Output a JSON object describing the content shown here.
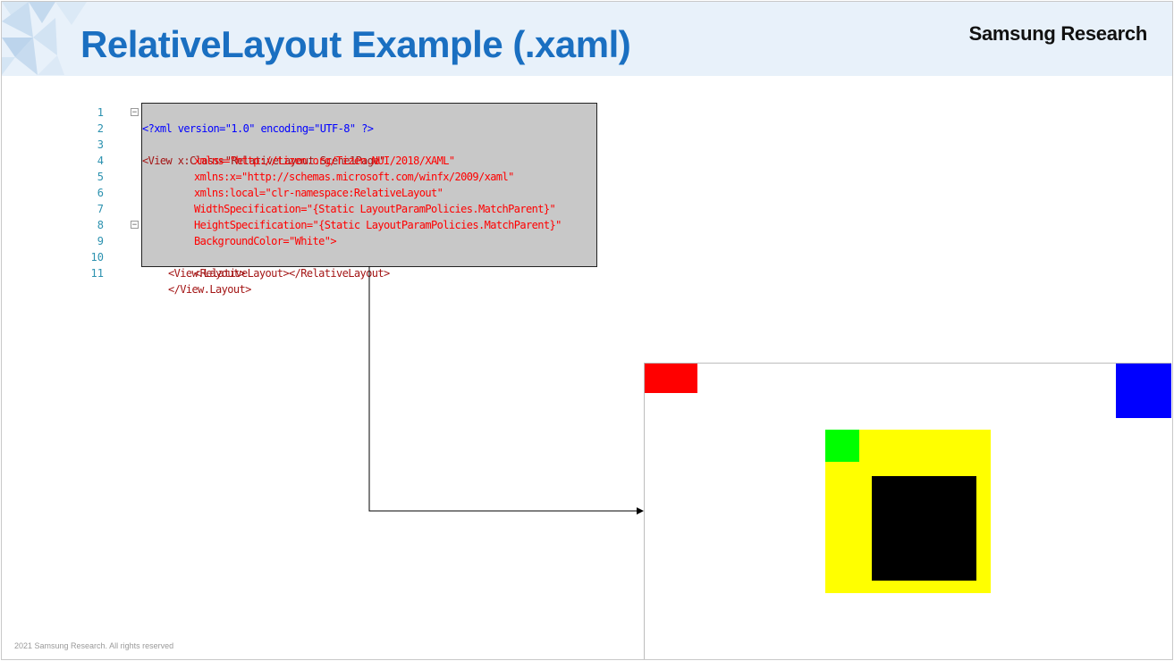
{
  "slide": {
    "title": "RelativeLayout Example (.xaml)",
    "brand": "Samsung Research",
    "footer": "2021 Samsung Research. All rights reserved"
  },
  "code": {
    "lines": [
      {
        "num": "1",
        "text": "<?xml version=\"1.0\" encoding=\"UTF-8\" ?>"
      },
      {
        "num": "2",
        "text": "<View x:Class=\"RelativeLayout.Scene1Page\""
      },
      {
        "num": "3",
        "text": "xmlns=\"http://tizen.org/Tizen.NUI/2018/XAML\""
      },
      {
        "num": "4",
        "text": "xmlns:x=\"http://schemas.microsoft.com/winfx/2009/xaml\""
      },
      {
        "num": "5",
        "text": "xmlns:local=\"clr-namespace:RelativeLayout\""
      },
      {
        "num": "6",
        "text": "WidthSpecification=\"{Static LayoutParamPolicies.MatchParent}\""
      },
      {
        "num": "7",
        "text": "HeightSpecification=\"{Static LayoutParamPolicies.MatchParent}\""
      },
      {
        "num": "8",
        "text": "BackgroundColor=\"White\">"
      },
      {
        "num": "9",
        "text": "<View.Layout>"
      },
      {
        "num": "10",
        "text": "<RelativeLayout></RelativeLayout>"
      },
      {
        "num": "11",
        "text": "</View.Layout>"
      }
    ]
  },
  "preview": {
    "boxes": [
      {
        "name": "red-box",
        "color": "#ff0000"
      },
      {
        "name": "blue-box",
        "color": "#0000ff"
      },
      {
        "name": "yellow-box",
        "color": "#ffff00"
      },
      {
        "name": "green-box",
        "color": "#00ff00"
      },
      {
        "name": "black-box",
        "color": "#000000"
      }
    ]
  },
  "colors": {
    "title": "#1a6fc1",
    "header_bg": "#e8f1fa",
    "line_number": "#2b91af",
    "xml_tag": "#a31515",
    "xml_attr": "#ff0000",
    "xml_value": "#0000ff"
  }
}
